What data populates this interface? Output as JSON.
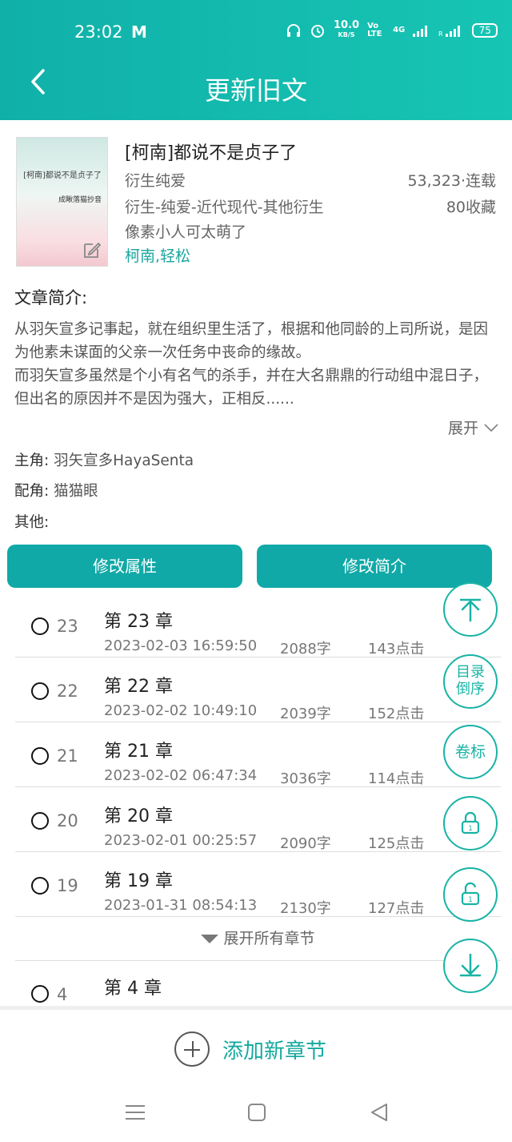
{
  "status": {
    "time": "23:02",
    "mail_icon": "M",
    "speed": "10.0",
    "speed_unit": "KB/S",
    "volte": "Vo LTE",
    "network": "4G",
    "battery": "75"
  },
  "header": {
    "title": "更新旧文"
  },
  "book": {
    "cover_title": "[柯南]都说不是贞子了",
    "cover_author": "成瞅落猫抄音",
    "name": "[柯南]都说不是贞子了",
    "category": "衍生纯爱",
    "wordcount": "53,323·连载",
    "tags": "衍生-纯爱-近代现代-其他衍生",
    "favorites": "80收藏",
    "tagline": "像素小人可太萌了",
    "author_tags": "柯南,轻松"
  },
  "summary": {
    "label": "文章简介:",
    "text": "从羽矢宣多记事起，就在组织里生活了，根据和他同龄的上司所说，是因为他素未谋面的父亲一次任务中丧命的缘故。\n而羽矢宣多虽然是个小有名气的杀手，并在大名鼎鼎的行动组中混日子，但出名的原因并不是因为强大，正相反......",
    "expand": "展开"
  },
  "roles": {
    "main_label": "主角:",
    "main_value": "羽矢宣多HayaSenta",
    "support_label": "配角:",
    "support_value": "猫猫眼",
    "other_label": "其他:",
    "other_value": ""
  },
  "buttons": {
    "edit_attrs": "修改属性",
    "edit_summary": "修改简介"
  },
  "chapters": [
    {
      "num": "23",
      "name": "第 23 章",
      "date": "2023-02-03 16:59:50",
      "words": "2088字",
      "clicks": "143点击"
    },
    {
      "num": "22",
      "name": "第 22 章",
      "date": "2023-02-02 10:49:10",
      "words": "2039字",
      "clicks": "152点击"
    },
    {
      "num": "21",
      "name": "第 21 章",
      "date": "2023-02-02 06:47:34",
      "words": "3036字",
      "clicks": "114点击"
    },
    {
      "num": "20",
      "name": "第 20 章",
      "date": "2023-02-01 00:25:57",
      "words": "2090字",
      "clicks": "125点击"
    },
    {
      "num": "19",
      "name": "第 19 章",
      "date": "2023-01-31 08:54:13",
      "words": "2130字",
      "clicks": "127点击"
    }
  ],
  "show_all": "展开所有章节",
  "last_chapter": {
    "num": "4",
    "name": "第 4 章"
  },
  "fabs": {
    "reverse": "目录\n倒序",
    "volume": "卷标"
  },
  "bottom": {
    "add_chapter": "添加新章节"
  },
  "colors": {
    "primary": "#10a9a7",
    "accent_text": "#19a79e"
  }
}
